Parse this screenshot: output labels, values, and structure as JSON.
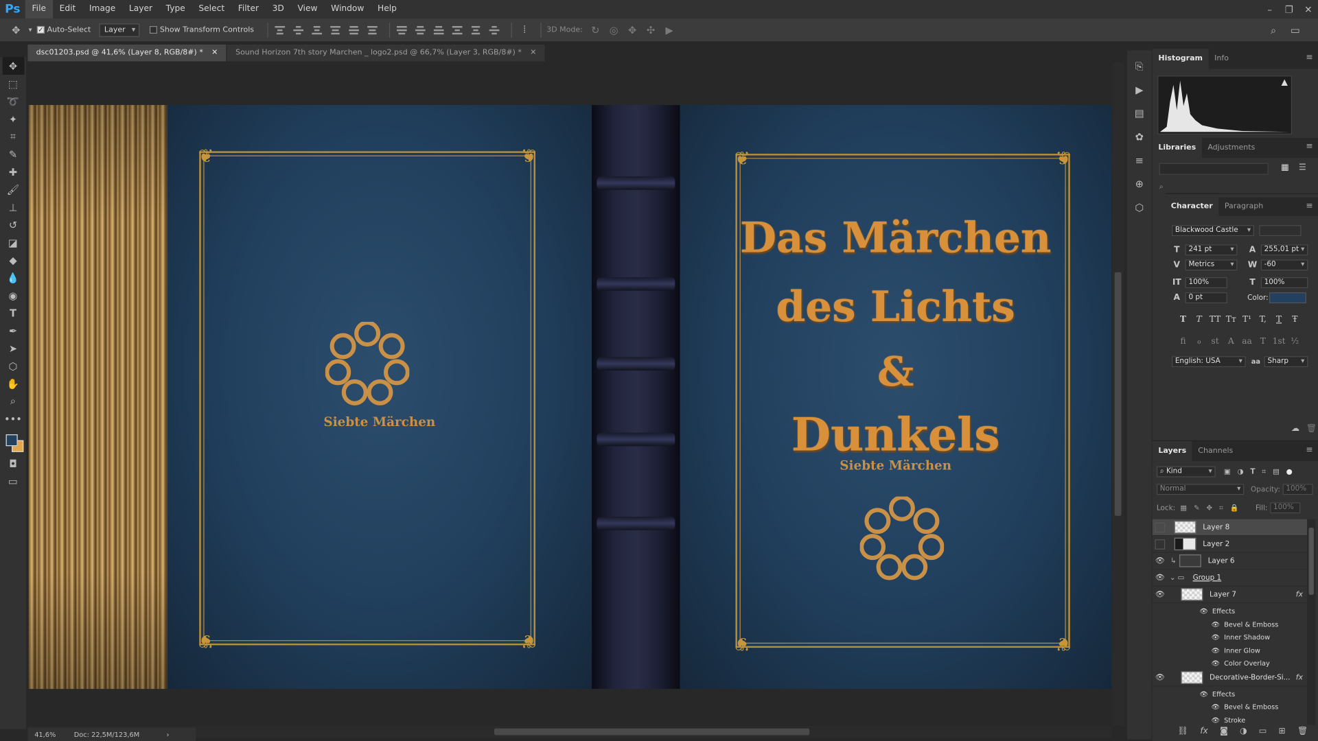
{
  "app": {
    "logo": "Ps",
    "menu": [
      "File",
      "Edit",
      "Image",
      "Layer",
      "Type",
      "Select",
      "Filter",
      "3D",
      "View",
      "Window",
      "Help"
    ],
    "window_controls": [
      "minimize-icon",
      "restore-icon",
      "close-icon"
    ]
  },
  "options": {
    "auto_select_label": "Auto-Select",
    "auto_select_checked": true,
    "target_value": "Layer",
    "show_transform_label": "Show Transform Controls",
    "mode_3d_label": "3D Mode:"
  },
  "tabs": [
    {
      "title": "dsc01203.psd @ 41,6% (Layer 8, RGB/8#) *",
      "active": true
    },
    {
      "title": "Sound Horizon 7th story Marchen _ logo2.psd @ 66,7% (Layer 3, RGB/8#) *",
      "active": false
    }
  ],
  "canvas": {
    "title_lines": [
      "Das Märchen",
      "des Lichts",
      "&",
      "Dunkels"
    ],
    "brand_front": "Siebte Märchen",
    "brand_back": "Siebte Märchen",
    "colors": {
      "cover": "#21405e",
      "gold": "#d8913a",
      "spine": "#20233a"
    }
  },
  "status": {
    "zoom": "41,6%",
    "doc": "Doc: 22,5M/123,6M"
  },
  "panels": {
    "histogram_tabs": [
      "Histogram",
      "Info"
    ],
    "libraries_tabs": [
      "Libraries",
      "Adjustments"
    ],
    "character_tabs": [
      "Character",
      "Paragraph"
    ],
    "layers_tabs": [
      "Layers",
      "Channels"
    ]
  },
  "character": {
    "font_family": "Blackwood Castle",
    "font_size": "241 pt",
    "leading": "255,01 pt",
    "kerning": "Metrics",
    "tracking": "-60",
    "vertical_scale": "100%",
    "horizontal_scale": "100%",
    "baseline_shift": "0 pt",
    "color_label": "Color:",
    "color_value": "#24405f",
    "language": "English: USA",
    "antialias": "Sharp",
    "style_buttons": [
      "T",
      "T",
      "TT",
      "Tт",
      "T¹",
      "T,",
      "T",
      "Ŧ"
    ],
    "opentype_buttons": [
      "fi",
      "ℴ",
      "st",
      "A",
      "aa",
      "T",
      "1st",
      "½"
    ]
  },
  "layers": {
    "filter_kind": "Kind",
    "blend_mode": "Normal",
    "opacity_label": "Opacity:",
    "opacity": "100%",
    "lock_label": "Lock:",
    "fill_label": "Fill:",
    "fill": "100%",
    "items": [
      {
        "name": "Layer 8",
        "visible": false,
        "selected": true
      },
      {
        "name": "Layer 2",
        "visible": false,
        "selected": false
      },
      {
        "name": "Layer 6",
        "visible": true,
        "selected": false
      },
      {
        "name": "Group 1",
        "visible": true,
        "selected": false
      },
      {
        "name": "Layer 7",
        "visible": true,
        "selected": false,
        "fx": "fx"
      },
      {
        "name": "Decorative-Border-Si...",
        "visible": true,
        "selected": false,
        "fx": "fx"
      }
    ],
    "layer7_effects_label": "Effects",
    "layer7_effects": [
      "Bevel & Emboss",
      "Inner Shadow",
      "Inner Glow",
      "Color Overlay"
    ],
    "border_effects_label": "Effects",
    "border_effects": [
      "Bevel & Emboss",
      "Stroke"
    ]
  }
}
